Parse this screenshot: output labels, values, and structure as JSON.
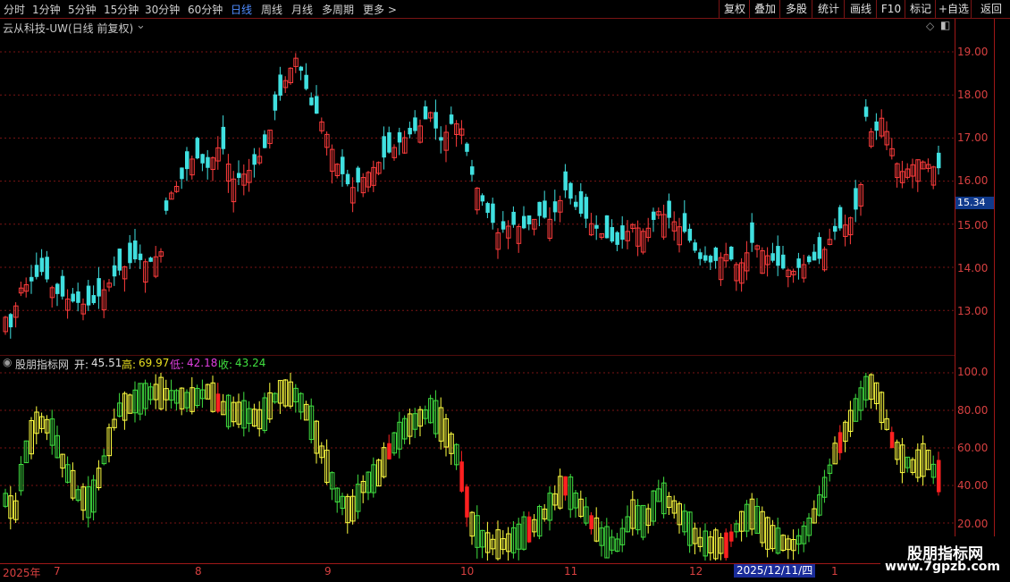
{
  "toolbar": {
    "left": [
      "分时",
      "1分钟",
      "5分钟",
      "15分钟",
      "30分钟",
      "60分钟",
      "日线",
      "周线",
      "月线",
      "多周期",
      "更多 >"
    ],
    "active": "日线",
    "right": [
      "复权",
      "叠加",
      "多股",
      "统计",
      "画线",
      "F10",
      "标记",
      "+自选",
      "返回"
    ]
  },
  "main": {
    "title": "云从科技-UW(日线 前复权)",
    "price_labels": [
      "19.00",
      "18.00",
      "17.00",
      "16.00",
      "15.00",
      "14.00",
      "13.00"
    ],
    "price_tag": "15.34"
  },
  "indicator": {
    "name": "股朋指标网",
    "open_label": "开:",
    "open_value": "45.51",
    "high_label": "高:",
    "high_value": "69.97",
    "low_label": "低:",
    "low_value": "42.18",
    "close_label": "收:",
    "close_value": "43.24",
    "labels": [
      "100.0",
      "80.00",
      "60.00",
      "40.00",
      "20.00"
    ]
  },
  "dates": {
    "year": "2025年",
    "months": [
      "7",
      "8",
      "9",
      "10",
      "11",
      "12",
      "1"
    ],
    "cursor": "2025/12/11/四"
  },
  "logo": {
    "title": "股朋指标网",
    "url": "www.7gpzb.com"
  },
  "colors": {
    "up": "#ff3c3c",
    "down": "#40e0e0",
    "bg": "#000000",
    "grid": "#7a1414"
  }
}
